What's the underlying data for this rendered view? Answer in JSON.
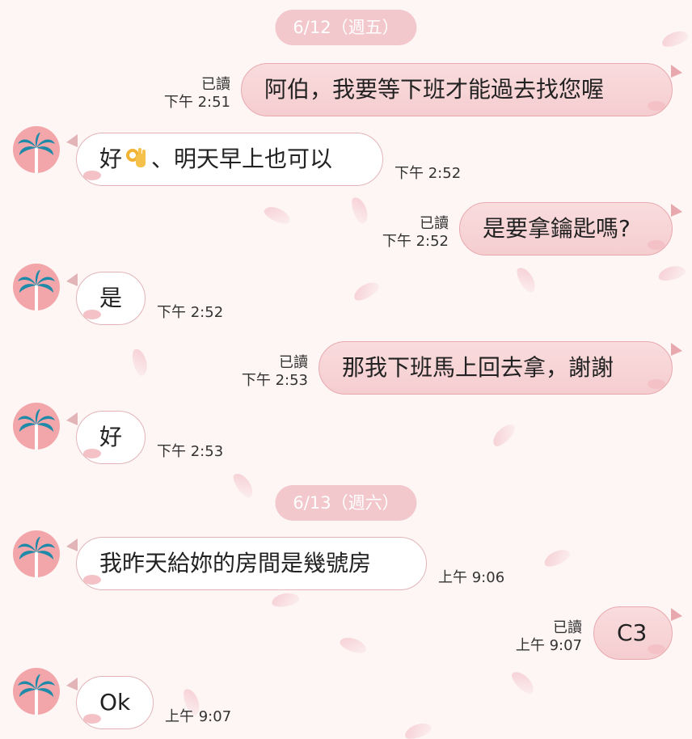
{
  "dates": [
    "6/12（週五）",
    "6/13（週六）"
  ],
  "read_label": "已讀",
  "messages": [
    {
      "text": "阿伯，我要等下班才能過去找您喔",
      "time": "下午 2:51"
    },
    {
      "text_before": "好",
      "emoji": "ok-hand",
      "text_after": "、明天早上也可以",
      "time": "下午 2:52"
    },
    {
      "text": "是要拿鑰匙嗎?",
      "time": "下午 2:52"
    },
    {
      "text": "是",
      "time": "下午 2:52"
    },
    {
      "text": "那我下班馬上回去拿，謝謝",
      "time": "下午 2:53"
    },
    {
      "text": "好",
      "time": "下午 2:53"
    },
    {
      "text": "我昨天給妳的房間是幾號房",
      "time": "上午 9:06"
    },
    {
      "text": "C3",
      "time": "上午 9:07"
    },
    {
      "text": "Ok",
      "time": "上午 9:07"
    }
  ],
  "colors": {
    "background": "#fdf6f5",
    "my_bubble": "#f7d3d5",
    "their_bubble": "#ffffff",
    "date_pill": "#f2c8cc",
    "avatar": "#f3a6aa",
    "palm_icon": "#1e8aa8"
  },
  "icons": {
    "avatar": "palm-tree-icon",
    "emoji": "ok-hand-emoji"
  }
}
